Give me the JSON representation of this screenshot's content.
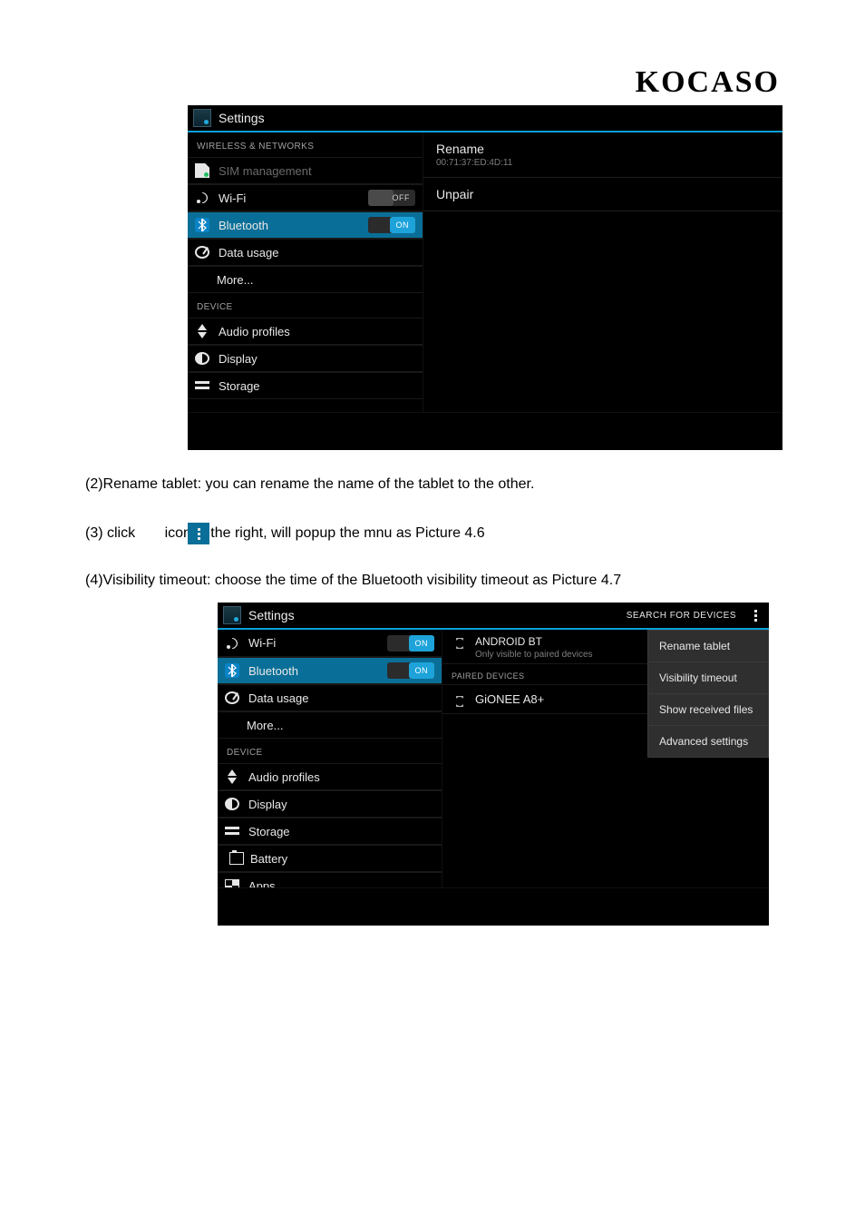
{
  "brand": "KOCASO",
  "paragraphs": {
    "p1": "(2)Rename tablet: you can rename the name of the tablet to the other.",
    "p2_before": "(3) click ",
    "p2_after": " icon in the right, will popup the mnu as Picture 4.6",
    "p3": "(4)Visibility timeout: choose the time of the Bluetooth visibility timeout as Picture 4.7"
  },
  "screenshot1": {
    "title": "Settings",
    "sections": {
      "wireless": "WIRELESS & NETWORKS",
      "device": "DEVICE"
    },
    "items": {
      "sim": "SIM management",
      "wifi": "Wi-Fi",
      "bluetooth": "Bluetooth",
      "datausage": "Data usage",
      "more": "More...",
      "audio": "Audio profiles",
      "display": "Display",
      "storage": "Storage"
    },
    "switch": {
      "off": "OFF",
      "on": "ON"
    },
    "right": {
      "rename": "Rename",
      "mac": "00:71:37:ED:4D:11",
      "unpair": "Unpair"
    }
  },
  "screenshot2": {
    "title": "Settings",
    "search": "SEARCH FOR DEVICES",
    "sections": {
      "device": "DEVICE"
    },
    "items": {
      "wifi": "Wi-Fi",
      "bluetooth": "Bluetooth",
      "datausage": "Data usage",
      "more": "More...",
      "audio": "Audio profiles",
      "display": "Display",
      "storage": "Storage",
      "battery": "Battery",
      "apps": "Apps"
    },
    "switch": {
      "on": "ON"
    },
    "bt_self": {
      "name": "ANDROID BT",
      "sub": "Only visible to paired devices"
    },
    "paired_header": "PAIRED DEVICES",
    "paired_devices": [
      {
        "name": "GiONEE A8+"
      }
    ],
    "menu": {
      "rename": "Rename tablet",
      "timeout": "Visibility timeout",
      "files": "Show received files",
      "adv": "Advanced settings"
    }
  }
}
